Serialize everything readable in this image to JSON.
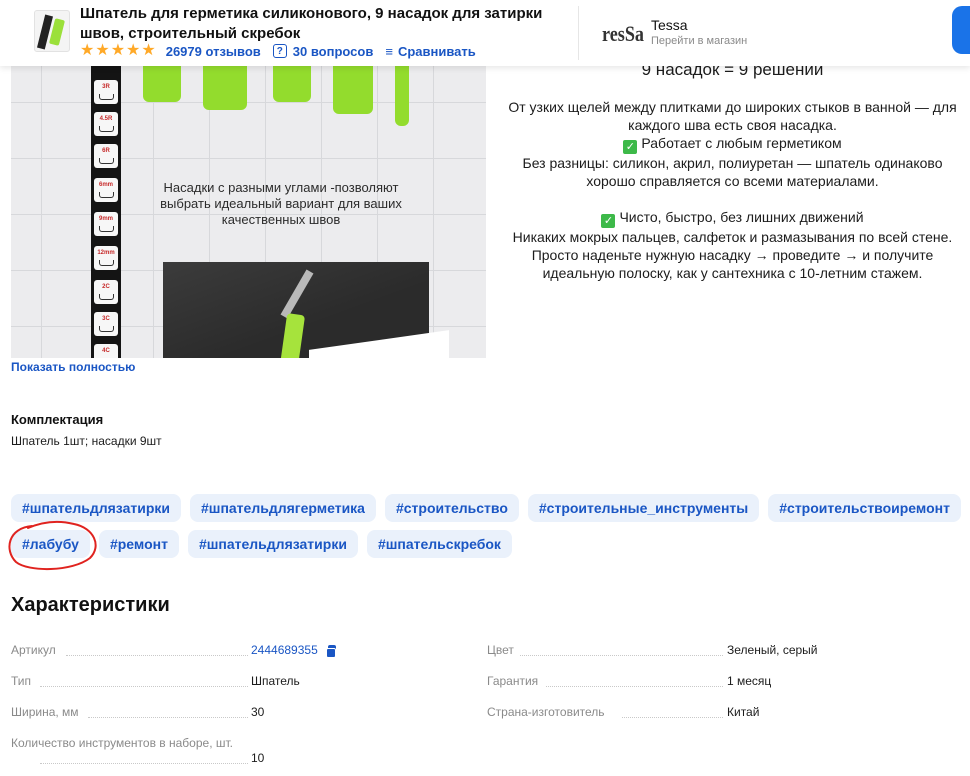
{
  "header": {
    "title": "Шпатель для герметика силиконового, 9 насадок для затирки швов, строительный скребок",
    "rating_stars": 5,
    "reviews": "26979 отзывов",
    "questions": "30 вопросов",
    "compare": "Сравнивать",
    "shop": {
      "logo_text": "resSa",
      "name": "Tessa",
      "link": "Перейти в магазин"
    },
    "colors": {
      "accent": "#1a56c4",
      "star": "#ffa928",
      "cta": "#1a73e8"
    }
  },
  "photo": {
    "caption": "Насадки с разными углами -позволяют выбрать идеальный вариант для ваших качественных швов",
    "nozzles": [
      "3R",
      "4.5R",
      "6R",
      "6mm",
      "9mm",
      "12mm",
      "2C",
      "3C",
      "4C"
    ]
  },
  "show_more": "Показать полностью",
  "description": {
    "heading": "9 насадок = 9 решений",
    "p1": "От узких щелей между плитками до широких стыков в ванной — для каждого шва есть своя насадка.",
    "p2_title": "Работает с любым герметиком",
    "p2": "Без разницы: силикон, акрил, полиуретан — шпатель одинаково хорошо справляется со всеми материалами.",
    "p3_title": "Чисто, быстро, без лишних движений",
    "p3": "Никаких мокрых пальцев, салфеток и размазывания по всей стене. Просто наденьте нужную насадку → проведите → и получите идеальную полоску, как у сантехника с 10-летним стажем."
  },
  "complectation": {
    "title": "Комплектация",
    "value": "Шпатель 1шт; насадки 9шт"
  },
  "tags": [
    "#шпательдлязатирки",
    "#шпательдлягерметика",
    "#строительство",
    "#строительные_инструменты",
    "#строительствоиремонт",
    "#лабубу",
    "#ремонт",
    "#шпательдлязатирки",
    "#шпательскребок"
  ],
  "characteristics": {
    "title": "Характеристики",
    "left": [
      {
        "label": "Артикул",
        "value": "2444689355"
      },
      {
        "label": "Тип",
        "value": "Шпатель"
      },
      {
        "label": "Ширина, мм",
        "value": "30"
      },
      {
        "label": "Количество инструментов в наборе, шт.",
        "value": "10"
      }
    ],
    "right": [
      {
        "label": "Цвет",
        "value": "Зеленый, серый"
      },
      {
        "label": "Гарантия",
        "value": "1 месяц"
      },
      {
        "label": "Страна-изготовитель",
        "value": "Китай"
      }
    ]
  }
}
